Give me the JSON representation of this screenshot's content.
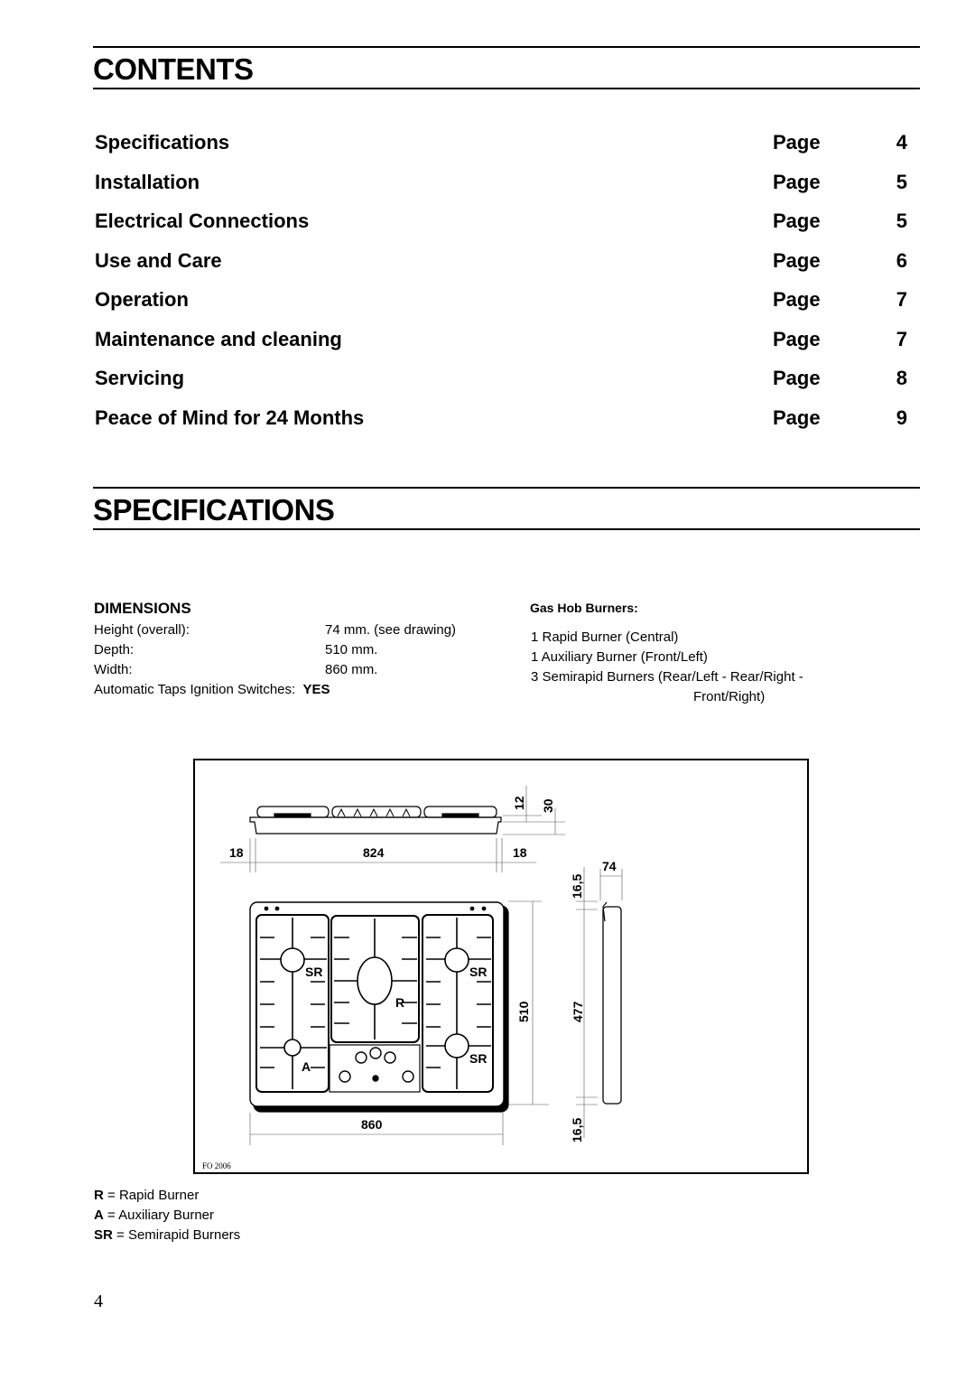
{
  "contents": {
    "title": "CONTENTS",
    "items": [
      {
        "label": "Specifications",
        "page_word": "Page",
        "page": "4"
      },
      {
        "label": "Installation",
        "page_word": "Page",
        "page": "5"
      },
      {
        "label": "Electrical Connections",
        "page_word": "Page",
        "page": "5"
      },
      {
        "label": "Use and Care",
        "page_word": "Page",
        "page": "6"
      },
      {
        "label": "Operation",
        "page_word": "Page",
        "page": "7"
      },
      {
        "label": "Maintenance and cleaning",
        "page_word": "Page",
        "page": "7"
      },
      {
        "label": "Servicing",
        "page_word": "Page",
        "page": "8"
      },
      {
        "label": "Peace of Mind for 24 Months",
        "page_word": "Page",
        "page": "9"
      }
    ]
  },
  "specifications": {
    "title": "SPECIFICATIONS",
    "dimensions": {
      "heading": "DIMENSIONS",
      "rows": [
        {
          "label": "Height (overall):",
          "value": "74 mm. (see drawing)"
        },
        {
          "label": "Depth:",
          "value": "510 mm."
        },
        {
          "label": "Width:",
          "value": "860 mm."
        }
      ],
      "ignition_label": "Automatic Taps Ignition Switches:",
      "ignition_value": "YES"
    },
    "burners": {
      "heading": "Gas Hob Burners:",
      "lines": [
        "1 Rapid Burner (Central)",
        "1 Auxiliary Burner (Front/Left)",
        "3 Semirapid Burners (Rear/Left - Rear/Right -",
        "Front/Right)"
      ]
    },
    "drawing": {
      "dims": {
        "side_left": "18",
        "inner_width": "824",
        "side_right": "18",
        "grate_height": "12",
        "total_height": "30",
        "depth_overall": "74",
        "margin_top": "16,5",
        "depth": "510",
        "inner_depth": "477",
        "margin_bottom": "16,5",
        "width": "860"
      },
      "labels": {
        "sr": "SR",
        "r": "R",
        "a": "A"
      },
      "code": "FO 2006"
    },
    "legend": [
      {
        "key": "R",
        "sep": " = ",
        "text": "Rapid Burner"
      },
      {
        "key": "A",
        "sep": " = ",
        "text": "Auxiliary Burner"
      },
      {
        "key": "SR",
        "sep": " = ",
        "text": "Semirapid Burners"
      }
    ]
  },
  "page_number": "4"
}
